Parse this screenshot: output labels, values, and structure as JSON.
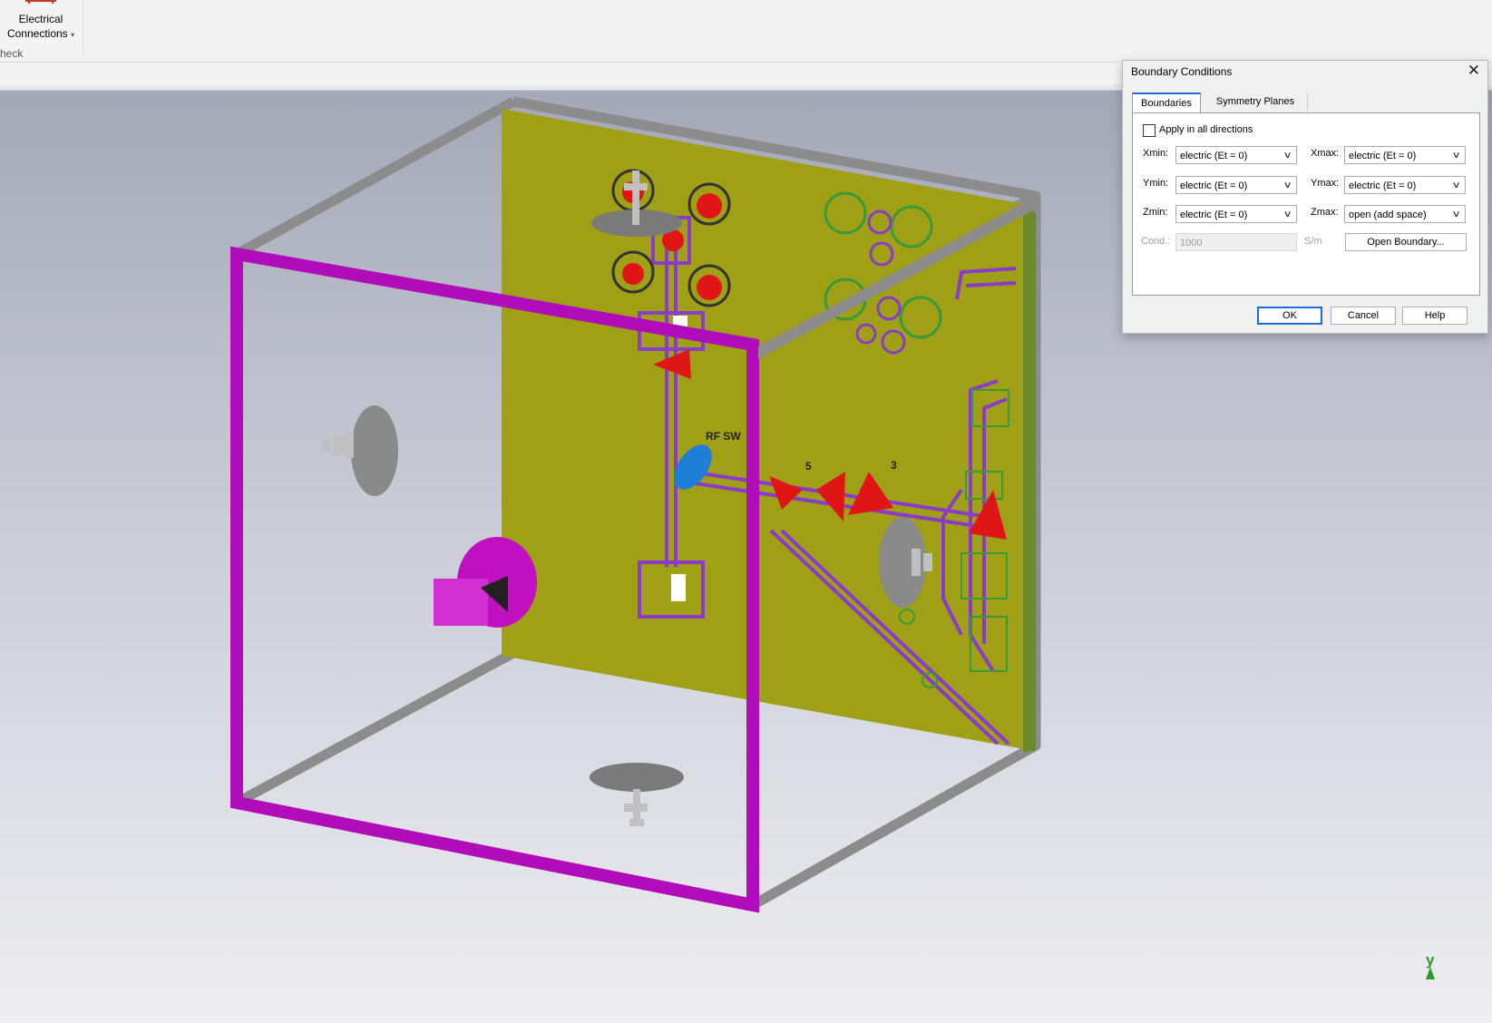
{
  "ribbon": {
    "button_line1": "Electrical",
    "button_line2": "Connections",
    "dropdown_caret": "▾",
    "group_label": "heck"
  },
  "viewport": {
    "port_labels": [
      "5",
      "3"
    ],
    "board_label": "RF SW",
    "axis_label": "y",
    "colors": {
      "pcb": "#a0a016",
      "trace": "#8a3cc8",
      "boundary_frame": "#b10cb9",
      "frame": "#8c8c8c",
      "port": "#e01616"
    }
  },
  "dialog": {
    "title": "Boundary Conditions",
    "close_symbol": "✕",
    "tabs": [
      "Boundaries",
      "Symmetry Planes"
    ],
    "apply_all_label": "Apply in all directions",
    "apply_all_checked": false,
    "fields": {
      "xmin_label": "Xmin:",
      "xmin_value": "electric (Et = 0)",
      "xmax_label": "Xmax:",
      "xmax_value": "electric (Et = 0)",
      "ymin_label": "Ymin:",
      "ymin_value": "electric (Et = 0)",
      "ymax_label": "Ymax:",
      "ymax_value": "electric (Et = 0)",
      "zmin_label": "Zmin:",
      "zmin_value": "electric (Et = 0)",
      "zmax_label": "Zmax:",
      "zmax_value": "open (add space)"
    },
    "cond_label": "Cond.:",
    "cond_value": "1000",
    "cond_unit": "S/m",
    "open_boundary_label": "Open Boundary...",
    "ok_label": "OK",
    "cancel_label": "Cancel",
    "help_label": "Help"
  }
}
